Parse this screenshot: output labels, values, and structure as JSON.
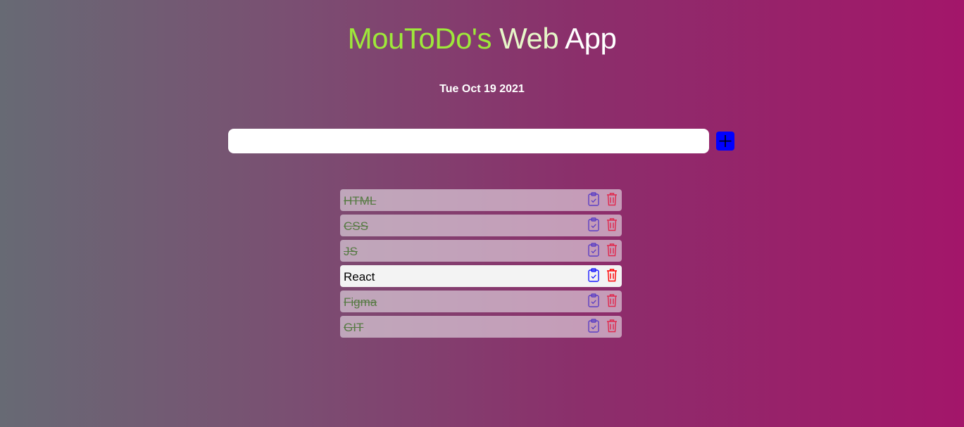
{
  "header": {
    "title_part1": "MouToDo's",
    "title_part2": " Web",
    "title_part3": " App",
    "date": "Tue Oct 19 2021"
  },
  "input": {
    "value": "",
    "placeholder": ""
  },
  "add_button": {
    "icon": "plus-icon",
    "color": "#0000ff"
  },
  "tasks": [
    {
      "label": "HTML",
      "completed": true
    },
    {
      "label": "CSS",
      "completed": true
    },
    {
      "label": "JS",
      "completed": true
    },
    {
      "label": "React",
      "completed": false
    },
    {
      "label": "Figma",
      "completed": true
    },
    {
      "label": "GIT",
      "completed": true
    }
  ],
  "icons": {
    "complete": "clipboard-check-icon",
    "delete": "trash-icon"
  },
  "colors": {
    "title_accent": "#9ee83a",
    "completed_text": "#567a43",
    "delete": "#e0284c",
    "check": "#5b3fc4"
  }
}
